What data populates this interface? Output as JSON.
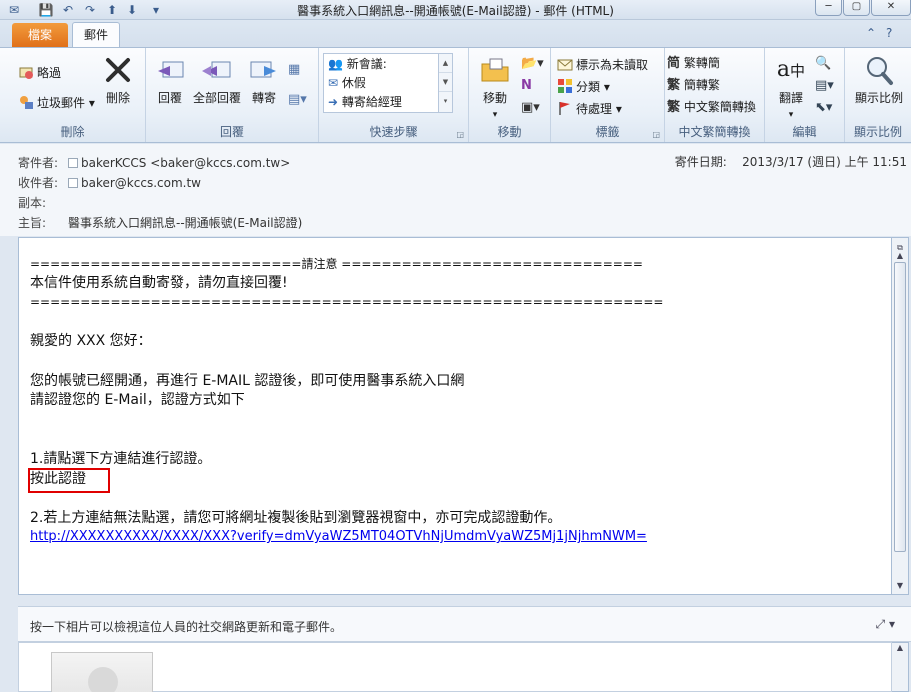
{
  "window": {
    "title": "醫事系統入口網訊息--開通帳號(E-Mail認證)  -  郵件 (HTML)",
    "help_icon": "?"
  },
  "tabs": {
    "file": "檔案",
    "message": "郵件"
  },
  "ribbon": {
    "delete_group": {
      "label": "刪除",
      "ignore": "略過",
      "junk": "垃圾郵件",
      "delete": "刪除"
    },
    "respond_group": {
      "label": "回覆",
      "reply": "回覆",
      "reply_all": "全部回覆",
      "forward": "轉寄"
    },
    "quicksteps_group": {
      "label": "快速步驟",
      "items": [
        "新會議:",
        "休假",
        "轉寄給經理"
      ]
    },
    "move_group": {
      "label": "移動",
      "move": "移動"
    },
    "tags_group": {
      "label": "標籤",
      "unread": "標示為未讀取",
      "categorize": "分類",
      "followup": "待處理"
    },
    "chinese_group": {
      "label": "中文繁簡轉換",
      "to_trad": "繁轉簡",
      "to_simp": "簡轉繁",
      "convert": "中文繁簡轉換"
    },
    "editing_group": {
      "label": "編輯",
      "translate": "翻譯"
    },
    "zoom_group": {
      "label": "顯示比例",
      "zoom": "顯示比例"
    }
  },
  "header": {
    "from_label": "寄件者:",
    "from_value": "bakerKCCS <baker@kccs.com.tw>",
    "to_label": "收件者:",
    "to_value": "baker@kccs.com.tw",
    "cc_label": "副本:",
    "subject_label": "主旨:",
    "subject_value": "醫事系統入口網訊息--開通帳號(E-Mail認證)",
    "sent_label": "寄件日期:",
    "sent_value": "2013/3/17 (週日) 上午 11:51"
  },
  "body": {
    "line1": "===========================請注意 ==============================",
    "line2": "本信件使用系統自動寄發，請勿直接回覆!",
    "line3": "===============================================================",
    "greeting": "親愛的 XXX 您好：",
    "para1": "您的帳號已經開通，再進行 E-MAIL 認證後，即可使用醫事系統入口網",
    "para2": "請認證您的 E-Mail，認證方式如下",
    "step1": "1.請點選下方連結進行認證。",
    "click_link": "按此認證",
    "step2": "2.若上方連結無法點選，請您可將網址複製後貼到瀏覽器視窗中，亦可完成認證動作。",
    "url": "http://XXXXXXXXXX/XXXX/XXX?verify=dmVyaWZ5MT04OTVhNjUmdmVyaWZ5Mj1jNjhmNWM=",
    "highlight_color": "#e00000"
  },
  "social": {
    "text": "按一下相片可以檢視這位人員的社交網路更新和電子郵件。"
  },
  "colors": {
    "file_tab": "#e0701a",
    "link": "#0000ee"
  }
}
